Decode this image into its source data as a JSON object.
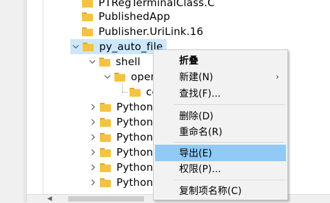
{
  "tree": {
    "items": [
      {
        "label": "PTRegTerminalClass.C",
        "expanded": null
      },
      {
        "label": "PublishedApp",
        "expanded": null
      },
      {
        "label": "Publisher.UriLink.16",
        "expanded": null
      },
      {
        "label": "py_auto_file",
        "expanded": true
      },
      {
        "label": "shell",
        "expanded": true
      },
      {
        "label": "oper",
        "expanded": true
      },
      {
        "label": "co",
        "expanded": null
      },
      {
        "label": "Python.Ar",
        "expanded": false
      },
      {
        "label": "Python.Co",
        "expanded": false
      },
      {
        "label": "Python.Ex",
        "expanded": false
      },
      {
        "label": "Python.Fil",
        "expanded": false
      },
      {
        "label": "Python.No",
        "expanded": false
      },
      {
        "label": "Python.No",
        "expanded": false
      }
    ]
  },
  "context_menu": {
    "items": [
      {
        "label": "折叠",
        "bold": true
      },
      {
        "label": "新建(N)",
        "has_submenu": true
      },
      {
        "label": "查找(F)..."
      },
      {
        "label": "删除(D)"
      },
      {
        "label": "重命名(R)"
      },
      {
        "label": "导出(E)",
        "highlighted": true
      },
      {
        "label": "权限(P)..."
      },
      {
        "label": "复制项名称(C)"
      }
    ],
    "highlight_color": "#91c9f7"
  },
  "colors": {
    "selection": "#cce8ff",
    "folder": "#f5c342"
  }
}
